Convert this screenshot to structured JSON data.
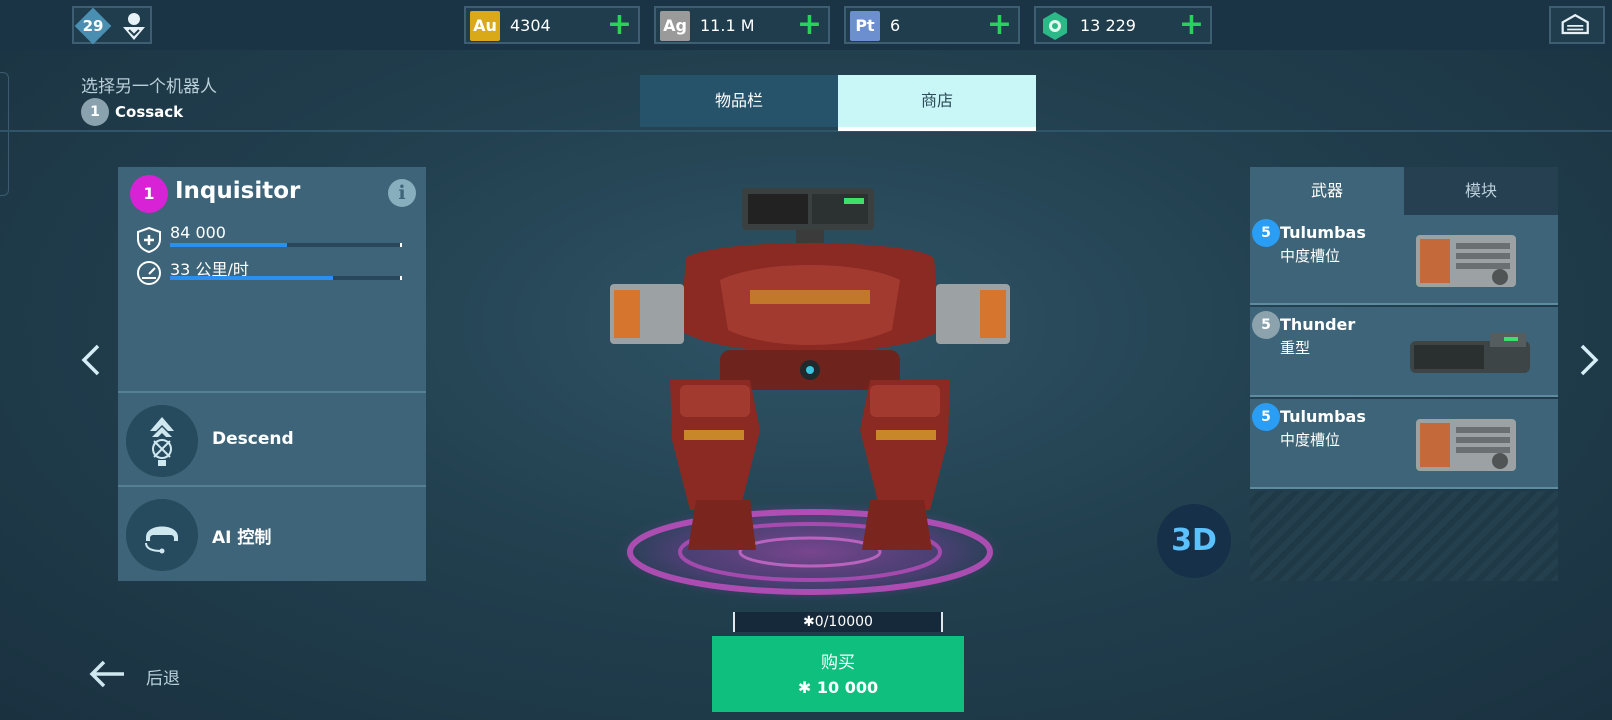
{
  "topbar": {
    "level": "29",
    "currencies": [
      {
        "code": "Au",
        "value": "4304",
        "color": "#d9a91a"
      },
      {
        "code": "Ag",
        "value": "11.1 M",
        "color": "#9a9a9a"
      },
      {
        "code": "Pt",
        "value": "6",
        "color": "#6c8fd0"
      },
      {
        "code": "",
        "value": "13 229",
        "color": "#2db887"
      }
    ]
  },
  "header": {
    "choose_label": "选择另一个机器人",
    "robot_level": "1",
    "robot_name": "Cossack",
    "tabs": [
      "物品栏",
      "商店"
    ],
    "active_tab": "商店"
  },
  "robot": {
    "rank": "1",
    "name": "Inquisitor",
    "stats": [
      {
        "label": "84 000",
        "icon": "shield-icon",
        "fill": 0.51
      },
      {
        "label": "33 公里/时",
        "icon": "speedometer-icon",
        "fill": 0.71
      }
    ],
    "abilities": [
      {
        "label": "Descend",
        "icon": "descend-icon"
      },
      {
        "label": "AI 控制",
        "icon": "ai-pilot-icon"
      }
    ]
  },
  "slots": {
    "tabs": [
      "武器",
      "模块"
    ],
    "active_tab": "武器",
    "weapons": [
      {
        "level": "5",
        "name": "Tulumbas",
        "type": "中度槽位",
        "badge_color": "#2a9df4"
      },
      {
        "level": "5",
        "name": "Thunder",
        "type": "重型",
        "badge_color": "#8ca3ae"
      },
      {
        "level": "5",
        "name": "Tulumbas",
        "type": "中度槽位",
        "badge_color": "#2a9df4"
      }
    ]
  },
  "view_toggle": "3D",
  "components": "0/10000",
  "purchase": {
    "label": "购买",
    "price": "10 000"
  },
  "back_label": "后退"
}
